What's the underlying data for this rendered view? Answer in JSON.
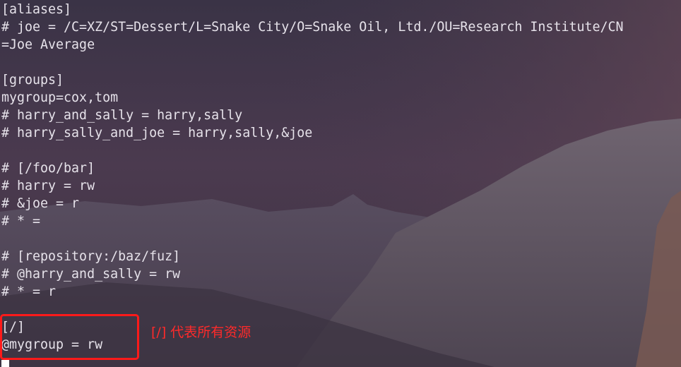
{
  "terminal": {
    "lines": [
      "[aliases]",
      "# joe = /C=XZ/ST=Dessert/L=Snake City/O=Snake Oil, Ltd./OU=Research Institute/CN",
      "=Joe Average",
      "",
      "[groups]",
      "mygroup=cox,tom",
      "# harry_and_sally = harry,sally",
      "# harry_sally_and_joe = harry,sally,&joe",
      "",
      "# [/foo/bar]",
      "# harry = rw",
      "# &joe = r",
      "# * =",
      "",
      "# [repository:/baz/fuz]",
      "# @harry_and_sally = rw",
      "# * = r",
      "",
      "[/]",
      "@mygroup = rw"
    ]
  },
  "annotation": {
    "note": "[/] 代表所有资源",
    "color": "#ff1a1a"
  },
  "colors": {
    "text": "#e6e2ea",
    "sky_top": "#5a4a5e",
    "sky_bottom": "#4a3b50",
    "mountain": "#6b5f6a"
  }
}
